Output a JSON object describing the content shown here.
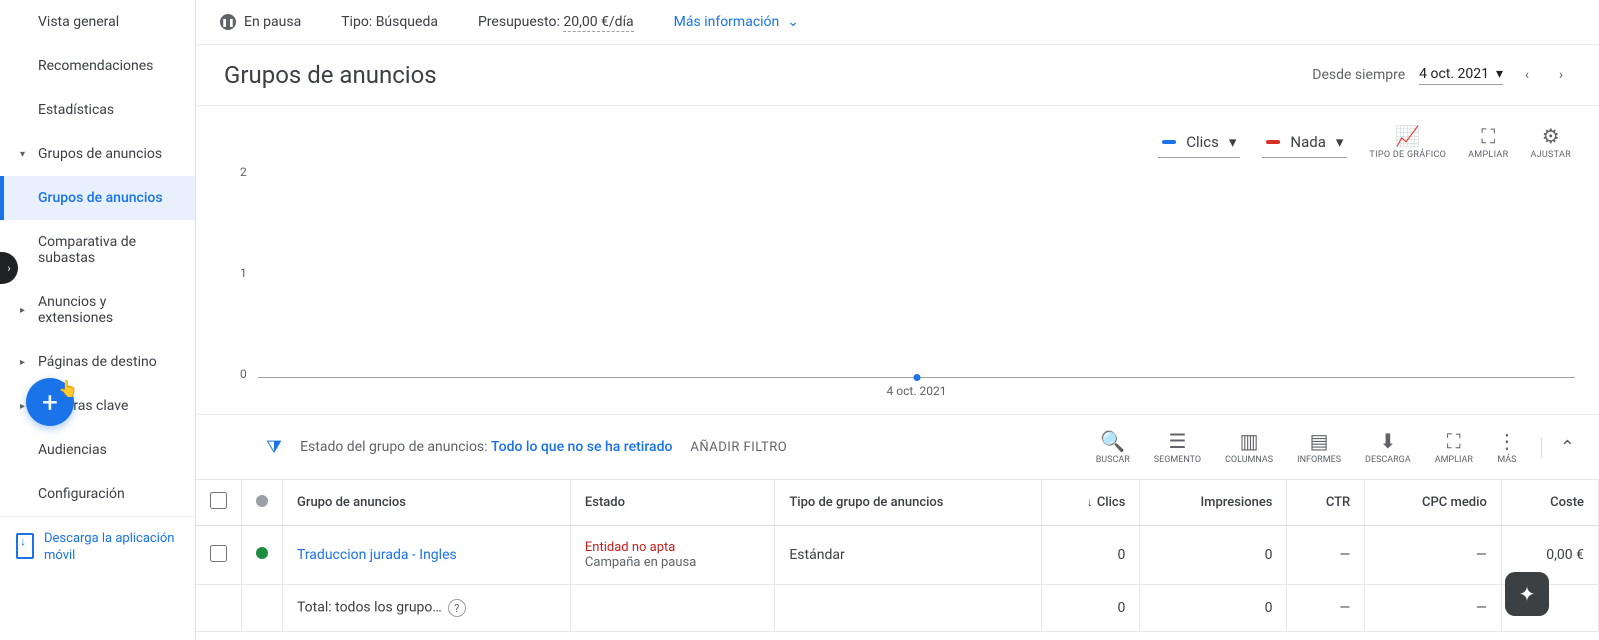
{
  "sidebar": {
    "items": [
      {
        "label": "Vista general"
      },
      {
        "label": "Recomendaciones"
      },
      {
        "label": "Estadísticas"
      },
      {
        "label": "Grupos de anuncios"
      },
      {
        "label": "Grupos de anuncios"
      },
      {
        "label": "Comparativa de subastas"
      },
      {
        "label": "Anuncios y extensiones"
      },
      {
        "label": "Páginas de destino"
      },
      {
        "label": "Palabras clave"
      },
      {
        "label": "Audiencias"
      },
      {
        "label": "Configuración"
      }
    ],
    "download": "Descarga la aplicación móvil"
  },
  "topbar": {
    "status": "En pausa",
    "type_label": "Tipo:",
    "type_value": "Búsqueda",
    "budget_label": "Presupuesto:",
    "budget_value": "20,00 €/día",
    "more_info": "Más información"
  },
  "header": {
    "title": "Grupos de anuncios",
    "range_label": "Desde siempre",
    "date": "4 oct. 2021"
  },
  "chart": {
    "metric1": "Clics",
    "metric2": "Nada",
    "ctrl1": "TIPO DE GRÁFICO",
    "ctrl2": "AMPLIAR",
    "ctrl3": "AJUSTAR"
  },
  "chart_data": {
    "type": "line",
    "x": [
      "4 oct. 2021"
    ],
    "series": [
      {
        "name": "Clics",
        "values": [
          0
        ],
        "color": "#1a73e8"
      }
    ],
    "ylim": [
      0,
      2
    ],
    "yticks": [
      0,
      1,
      2
    ],
    "xlabel": "4 oct. 2021"
  },
  "filter": {
    "label": "Estado del grupo de anuncios:",
    "value": "Todo lo que no se ha retirado",
    "add": "AÑADIR FILTRO"
  },
  "tools": {
    "search": "BUSCAR",
    "segment": "SEGMENTO",
    "columns": "COLUMNAS",
    "reports": "INFORMES",
    "download": "DESCARGA",
    "expand": "AMPLIAR",
    "more": "MÁS"
  },
  "table": {
    "headers": {
      "group": "Grupo de anuncios",
      "state": "Estado",
      "type": "Tipo de grupo de anuncios",
      "clicks": "Clics",
      "impr": "Impresiones",
      "ctr": "CTR",
      "cpc": "CPC medio",
      "cost": "Coste"
    },
    "rows": [
      {
        "status_color": "#1e8e3e",
        "name": "Traduccion jurada - Ingles",
        "state_err": "Entidad no apta",
        "state_sub": "Campaña en pausa",
        "type": "Estándar",
        "clicks": "0",
        "impr": "0",
        "ctr": "—",
        "cpc": "—",
        "cost": "0,00 €"
      }
    ],
    "total": {
      "label": "Total: todos los grupo…",
      "clicks": "0",
      "impr": "0",
      "ctr": "—",
      "cpc": "—",
      "cost": ""
    }
  }
}
